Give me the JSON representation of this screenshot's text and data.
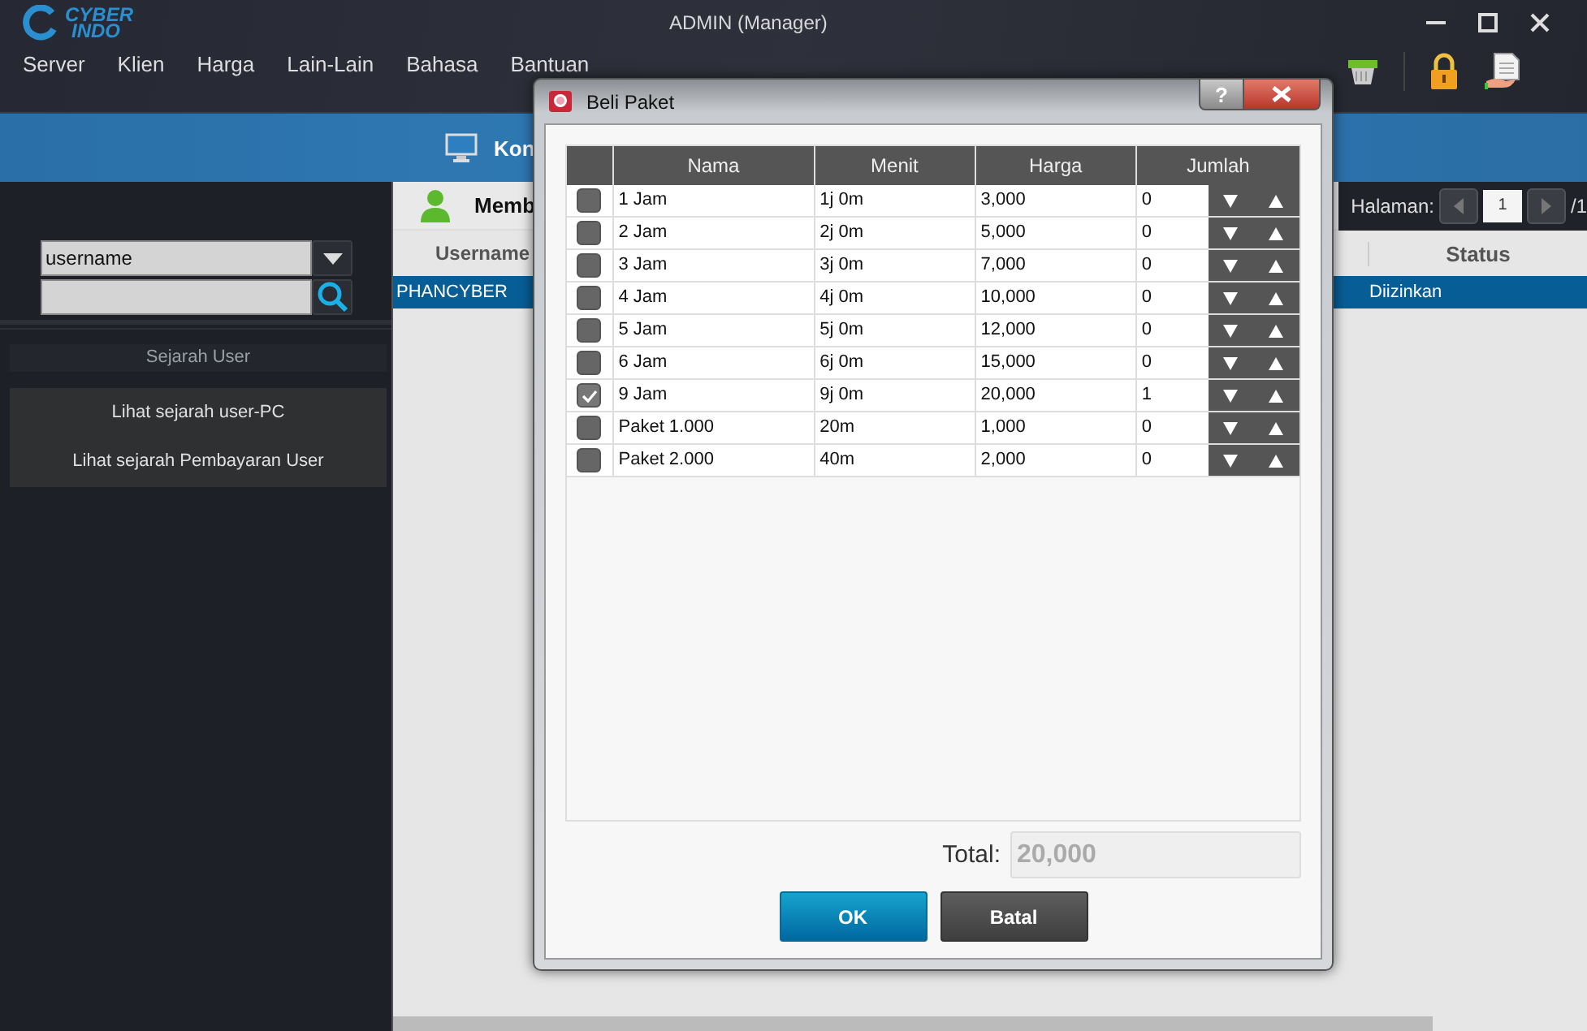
{
  "window": {
    "logo": [
      "CYBER",
      "INDO"
    ],
    "title": "ADMIN (Manager)"
  },
  "menu": [
    "Server",
    "Klien",
    "Harga",
    "Lain-Lain",
    "Bahasa",
    "Bantuan"
  ],
  "banner": {
    "label": "Kon"
  },
  "sidebar": {
    "filter_select": {
      "value": "username"
    },
    "section_title": "Sejarah User",
    "links": [
      "Lihat sejarah user-PC",
      "Lihat sejarah Pembayaran User"
    ]
  },
  "main": {
    "title": "Memb",
    "pager": {
      "label": "Halaman:",
      "page": "1",
      "total": "/1"
    },
    "columns": [
      "Username",
      "Status"
    ],
    "rows": [
      {
        "username": "PHANCYBER",
        "status": "Diizinkan",
        "selected": true
      }
    ]
  },
  "dialog": {
    "title": "Beli Paket",
    "help": "?",
    "columns": [
      "Nama",
      "Menit",
      "Harga",
      "Jumlah"
    ],
    "rows": [
      {
        "checked": false,
        "nama": "1 Jam",
        "menit": "1j 0m",
        "harga": "3,000",
        "jumlah": "0"
      },
      {
        "checked": false,
        "nama": "2 Jam",
        "menit": "2j 0m",
        "harga": "5,000",
        "jumlah": "0"
      },
      {
        "checked": false,
        "nama": "3 Jam",
        "menit": "3j 0m",
        "harga": "7,000",
        "jumlah": "0"
      },
      {
        "checked": false,
        "nama": "4 Jam",
        "menit": "4j 0m",
        "harga": "10,000",
        "jumlah": "0"
      },
      {
        "checked": false,
        "nama": "5 Jam",
        "menit": "5j 0m",
        "harga": "12,000",
        "jumlah": "0"
      },
      {
        "checked": false,
        "nama": "6 Jam",
        "menit": "6j 0m",
        "harga": "15,000",
        "jumlah": "0"
      },
      {
        "checked": true,
        "nama": "9 Jam",
        "menit": "9j 0m",
        "harga": "20,000",
        "jumlah": "1"
      },
      {
        "checked": false,
        "nama": "Paket 1.000",
        "menit": "20m",
        "harga": "1,000",
        "jumlah": "0"
      },
      {
        "checked": false,
        "nama": "Paket 2.000",
        "menit": "40m",
        "harga": "2,000",
        "jumlah": "0"
      }
    ],
    "total_label": "Total:",
    "total_value": "20,000",
    "buttons": [
      {
        "kind": "primary",
        "label": "OK"
      },
      {
        "kind": "secondary",
        "label": "Batal"
      }
    ]
  }
}
